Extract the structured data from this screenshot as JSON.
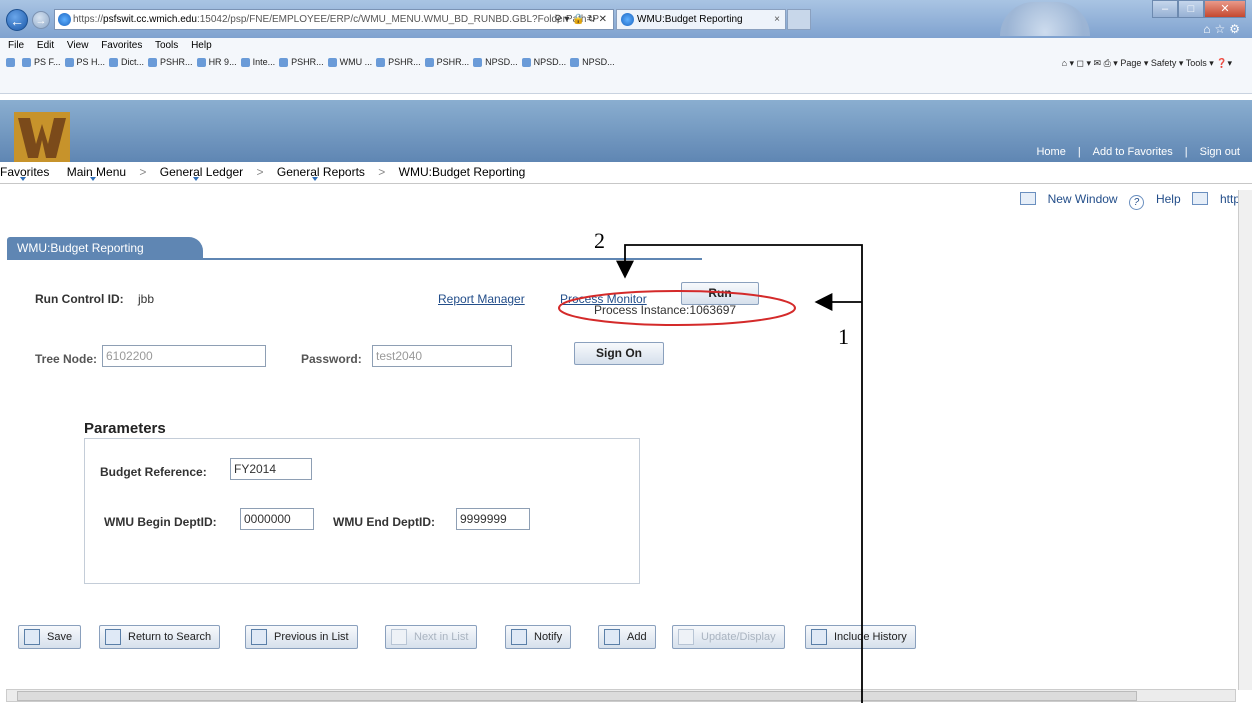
{
  "browser": {
    "url_prefix": "https://",
    "url_host": "psfswit.cc.wmich.edu",
    "url_rest": ":15042/psp/FNE/EMPLOYEE/ERP/c/WMU_MENU.WMU_BD_RUNBD.GBL?FolderPath=P",
    "tab_title": "WMU:Budget Reporting",
    "menu": [
      "File",
      "Edit",
      "View",
      "Favorites",
      "Tools",
      "Help"
    ],
    "favorites": [
      "PS F...",
      "PS H...",
      "Dict...",
      "PSHR...",
      "HR 9...",
      "Inte...",
      "PSHR...",
      "WMU ...",
      "PSHR...",
      "PSHR...",
      "NPSD...",
      "NPSD...",
      "NPSD..."
    ],
    "commands": "Page ▾   Safety ▾   Tools ▾"
  },
  "header": {
    "home": "Home",
    "add_to_favorites": "Add to Favorites",
    "sign_out": "Sign out",
    "logo_letter": "W"
  },
  "breadcrumb": {
    "favorites": "Favorites",
    "main_menu": "Main Menu",
    "general_ledger": "General Ledger",
    "general_reports": "General Reports",
    "current": "WMU:Budget Reporting"
  },
  "utility": {
    "new_window": "New Window",
    "help": "Help",
    "http": "http"
  },
  "page": {
    "tab_label": "WMU:Budget Reporting",
    "run_control_label": "Run Control ID:",
    "run_control_value": "jbb",
    "report_manager": "Report Manager",
    "process_monitor": "Process Monitor",
    "run_button": "Run",
    "process_instance_label": "Process Instance:",
    "process_instance_value": "1063697",
    "tree_node_label": "Tree Node:",
    "tree_node_value": "6102200",
    "password_label": "Password:",
    "password_value": "test2040",
    "sign_on_button": "Sign On"
  },
  "parameters": {
    "title": "Parameters",
    "budget_reference_label": "Budget Reference:",
    "budget_reference_value": "FY2014",
    "begin_dept_label": "WMU Begin DeptID:",
    "begin_dept_value": "0000000",
    "end_dept_label": "WMU End DeptID:",
    "end_dept_value": "9999999"
  },
  "toolbar": {
    "save": "Save",
    "return_to_search": "Return to Search",
    "previous_in_list": "Previous in List",
    "next_in_list": "Next in List",
    "notify": "Notify",
    "add": "Add",
    "update_display": "Update/Display",
    "include_history": "Include History"
  },
  "annotations": {
    "step_1": "1",
    "step_2": "2"
  },
  "colors": {
    "header_blue": "#5f86b3",
    "link_blue": "#234e8a",
    "annotation_red": "#d42a2a"
  }
}
